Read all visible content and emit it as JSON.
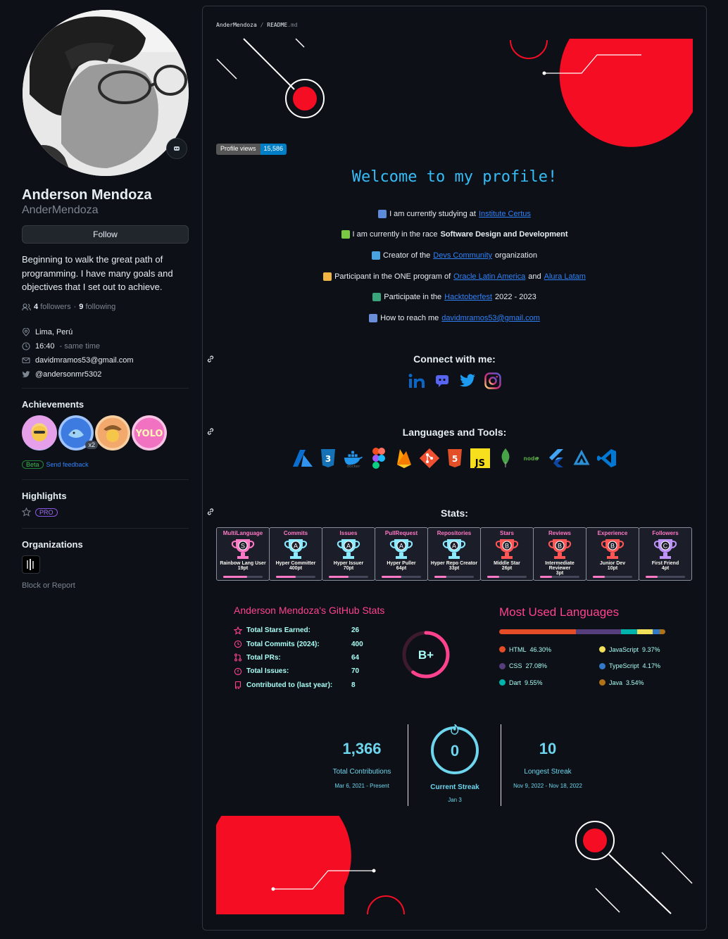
{
  "profile": {
    "fullname": "Anderson Mendoza",
    "username": "AnderMendoza",
    "follow_label": "Follow",
    "bio": "Beginning to walk the great path of programming. I have many goals and objectives that I set out to achieve.",
    "followers_count": "4",
    "followers_label": "followers",
    "following_count": "9",
    "following_label": "following",
    "location": "Lima, Perú",
    "time": "16:40",
    "time_suffix": "- same time",
    "email": "davidmramos53@gmail.com",
    "twitter": "@andersonmr5302",
    "achievements_title": "Achievements",
    "achievement_count_badge": "x2",
    "beta_label": "Beta",
    "feedback_label": "Send feedback",
    "highlights_title": "Highlights",
    "pro_label": "PRO",
    "organizations_title": "Organizations",
    "block_report": "Block or Report",
    "status_icon": "status-emoji-icon"
  },
  "readme": {
    "breadcrumb_user": "AnderMendoza",
    "breadcrumb_sep": "/",
    "breadcrumb_file": "README",
    "breadcrumb_ext": ".md",
    "views_label": "Profile views",
    "views_value": "15,586",
    "welcome": "Welcome to my profile!",
    "intro": [
      {
        "pre": "I am currently studying at",
        "link": "Institute Certus",
        "post": "",
        "icon_color": "#5b8bd9"
      },
      {
        "pre": "I am currently in the race",
        "bold": "Software Design and Development",
        "icon_color": "#7ac943"
      },
      {
        "pre": "Creator of the",
        "link": "Devs Community",
        "post": "organization",
        "icon_color": "#4aa3df"
      },
      {
        "pre": "Participant in the ONE program of",
        "link": "Oracle Latin America",
        "mid": "and",
        "link2": "Alura Latam",
        "icon_color": "#f2b544"
      },
      {
        "pre": "Participate in the",
        "link": "Hacktoberfest",
        "post": "2022 - 2023",
        "icon_color": "#3aa57c"
      },
      {
        "pre": "How to reach me",
        "link": "davidmramos53@gmail.com",
        "icon_color": "#6a8fd8"
      }
    ],
    "connect_title": "Connect with me:",
    "social_icons": [
      "linkedin-icon",
      "discord-icon",
      "twitter-icon",
      "instagram-icon"
    ],
    "languages_title": "Languages and Tools:",
    "tool_icons": [
      "azure-icon",
      "css3-icon",
      "docker-icon",
      "figma-icon",
      "firebase-icon",
      "git-icon",
      "html5-icon",
      "javascript-icon",
      "mongodb-icon",
      "nodejs-icon",
      "flutter-icon",
      "appwrite-icon",
      "vscode-icon"
    ],
    "stats_title": "Stats:",
    "trophies": [
      {
        "title": "MultiLanguage",
        "grade": "S",
        "rank": "Rainbow Lang User",
        "points": "19pt",
        "fill": 0.6
      },
      {
        "title": "Commits",
        "grade": "A",
        "rank": "Hyper Committer",
        "points": "400pt",
        "fill": 0.5
      },
      {
        "title": "Issues",
        "grade": "A",
        "rank": "Hyper Issuer",
        "points": "70pt",
        "fill": 0.5
      },
      {
        "title": "PullRequest",
        "grade": "A",
        "rank": "Hyper Puller",
        "points": "64pt",
        "fill": 0.5
      },
      {
        "title": "Repositories",
        "grade": "A",
        "rank": "Hyper Repo Creator",
        "points": "33pt",
        "fill": 0.3
      },
      {
        "title": "Stars",
        "grade": "B",
        "rank": "Middle Star",
        "points": "26pt",
        "fill": 0.3
      },
      {
        "title": "Reviews",
        "grade": "B",
        "rank": "Intermediate Reviewer",
        "points": "3pt",
        "fill": 0.3
      },
      {
        "title": "Experience",
        "grade": "B",
        "rank": "Junior Dev",
        "points": "10pt",
        "fill": 0.3
      },
      {
        "title": "Followers",
        "grade": "C",
        "rank": "First Friend",
        "points": "4pt",
        "fill": 0.3
      }
    ],
    "github_stats": {
      "title": "Anderson Mendoza's GitHub Stats",
      "rows": [
        {
          "label": "Total Stars Earned:",
          "value": "26",
          "icon": "star-icon"
        },
        {
          "label": "Total Commits (2024):",
          "value": "400",
          "icon": "history-icon"
        },
        {
          "label": "Total PRs:",
          "value": "64",
          "icon": "pull-request-icon"
        },
        {
          "label": "Total Issues:",
          "value": "70",
          "icon": "issue-icon"
        },
        {
          "label": "Contributed to (last year):",
          "value": "8",
          "icon": "repo-icon"
        }
      ],
      "grade": "B+",
      "grade_progress": 0.6
    },
    "languages": {
      "title": "Most Used Languages",
      "items": [
        {
          "name": "HTML",
          "percent": "46.30%",
          "value": 46.3,
          "color": "#e34c26"
        },
        {
          "name": "JavaScript",
          "percent": "9.37%",
          "value": 9.37,
          "color": "#f1e05a"
        },
        {
          "name": "CSS",
          "percent": "27.08%",
          "value": 27.08,
          "color": "#563d7c"
        },
        {
          "name": "TypeScript",
          "percent": "4.17%",
          "value": 4.17,
          "color": "#3178c6"
        },
        {
          "name": "Dart",
          "percent": "9.55%",
          "value": 9.55,
          "color": "#00b4ab"
        },
        {
          "name": "Java",
          "percent": "3.54%",
          "value": 3.54,
          "color": "#b07219"
        }
      ]
    },
    "streak": {
      "total": "1,366",
      "total_label": "Total Contributions",
      "total_range": "Mar 6, 2021 - Present",
      "current": "0",
      "current_label": "Current Streak",
      "current_date": "Jan 3",
      "longest": "10",
      "longest_label": "Longest Streak",
      "longest_range": "Nov 9, 2022 - Nov 18, 2022"
    }
  },
  "colors": {
    "accent_red": "#f50d23",
    "link": "#2f81f7",
    "welcome": "#36bcf7",
    "stats_pink": "#fe428e",
    "stats_cyan": "#a9fef7"
  }
}
